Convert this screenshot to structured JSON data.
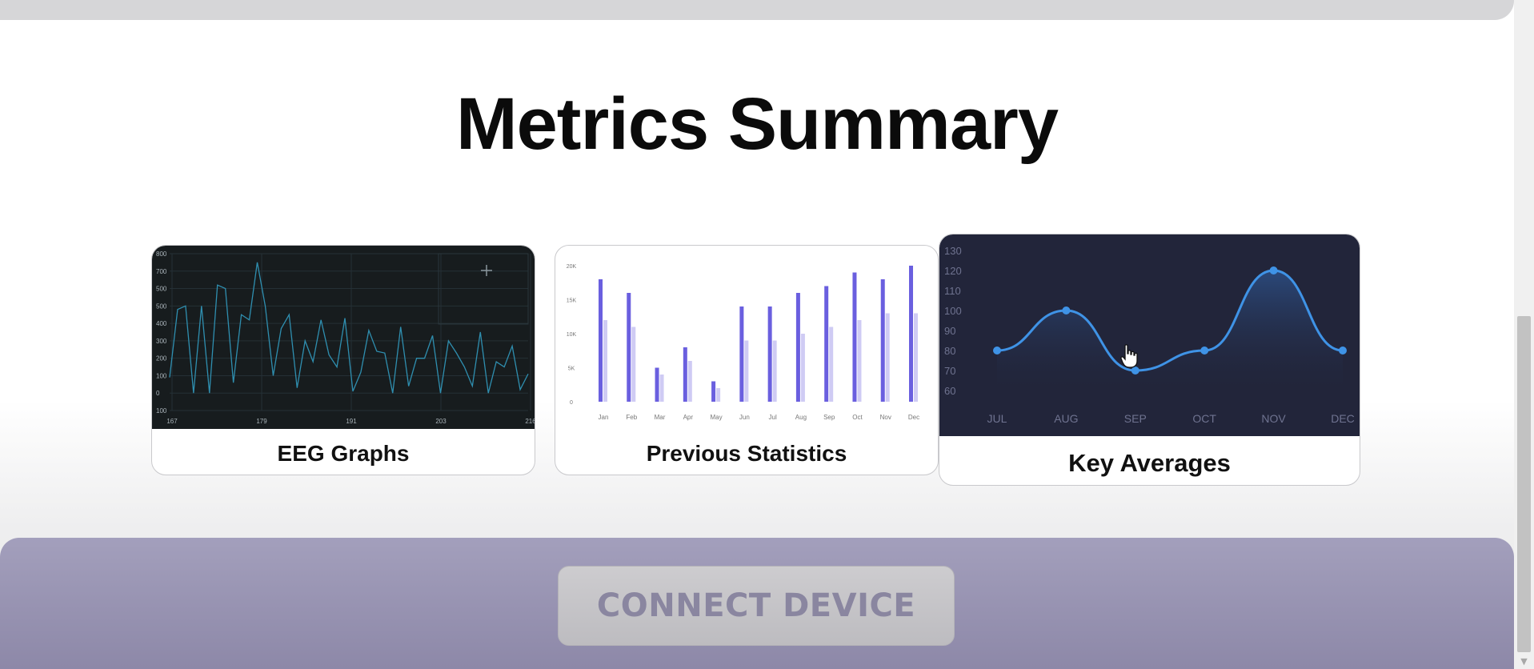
{
  "page": {
    "title": "Metrics Summary"
  },
  "cards": [
    {
      "label": "EEG Graphs"
    },
    {
      "label": "Previous Statistics"
    },
    {
      "label": "Key Averages"
    }
  ],
  "cta": {
    "label": "CONNECT DEVICE"
  },
  "chart_data": [
    {
      "type": "line",
      "x_ticks": [
        "167",
        "179",
        "191",
        "203",
        "216"
      ],
      "y_ticks": [
        "800",
        "700",
        "500",
        "500",
        "400",
        "300",
        "200",
        "100",
        "0",
        "100"
      ],
      "ylim": [
        -100,
        800
      ],
      "values": [
        90,
        480,
        500,
        0,
        500,
        0,
        620,
        600,
        60,
        450,
        420,
        750,
        500,
        100,
        370,
        450,
        30,
        300,
        180,
        420,
        220,
        150,
        430,
        10,
        120,
        360,
        240,
        230,
        0,
        380,
        40,
        200,
        200,
        330,
        0,
        300,
        230,
        150,
        40,
        350,
        0,
        180,
        150,
        270,
        20,
        110
      ],
      "colors": {
        "background": "#171c1e",
        "line": "#2f8fb0",
        "grid": "#253036"
      }
    },
    {
      "type": "bar",
      "categories": [
        "Jan",
        "Feb",
        "Mar",
        "Apr",
        "May",
        "Jun",
        "Jul",
        "Aug",
        "Sep",
        "Oct",
        "Nov",
        "Dec"
      ],
      "y_ticks": [
        "20K",
        "15K",
        "10K",
        "5K",
        "0"
      ],
      "ylim": [
        0,
        20000
      ],
      "series": [
        {
          "values": [
            18000,
            16000,
            5000,
            8000,
            3000,
            14000,
            14000,
            16000,
            17000,
            19000,
            18000,
            20000
          ]
        },
        {
          "values": [
            12000,
            11000,
            4000,
            6000,
            2000,
            9000,
            9000,
            10000,
            11000,
            12000,
            13000,
            13000
          ]
        }
      ],
      "colors": [
        "#6a5fdf",
        "#cfcbf4"
      ]
    },
    {
      "type": "area",
      "categories": [
        "JUL",
        "AUG",
        "SEP",
        "OCT",
        "NOV",
        "DEC"
      ],
      "y_ticks": [
        "130",
        "120",
        "110",
        "100",
        "90",
        "80",
        "70",
        "60"
      ],
      "ylim": [
        60,
        130
      ],
      "values": [
        80,
        100,
        70,
        80,
        120,
        80
      ],
      "colors": {
        "background": "#22253a",
        "line": "#3f93e6",
        "fill": "#2c4f86",
        "text": "#6f7390"
      }
    }
  ]
}
